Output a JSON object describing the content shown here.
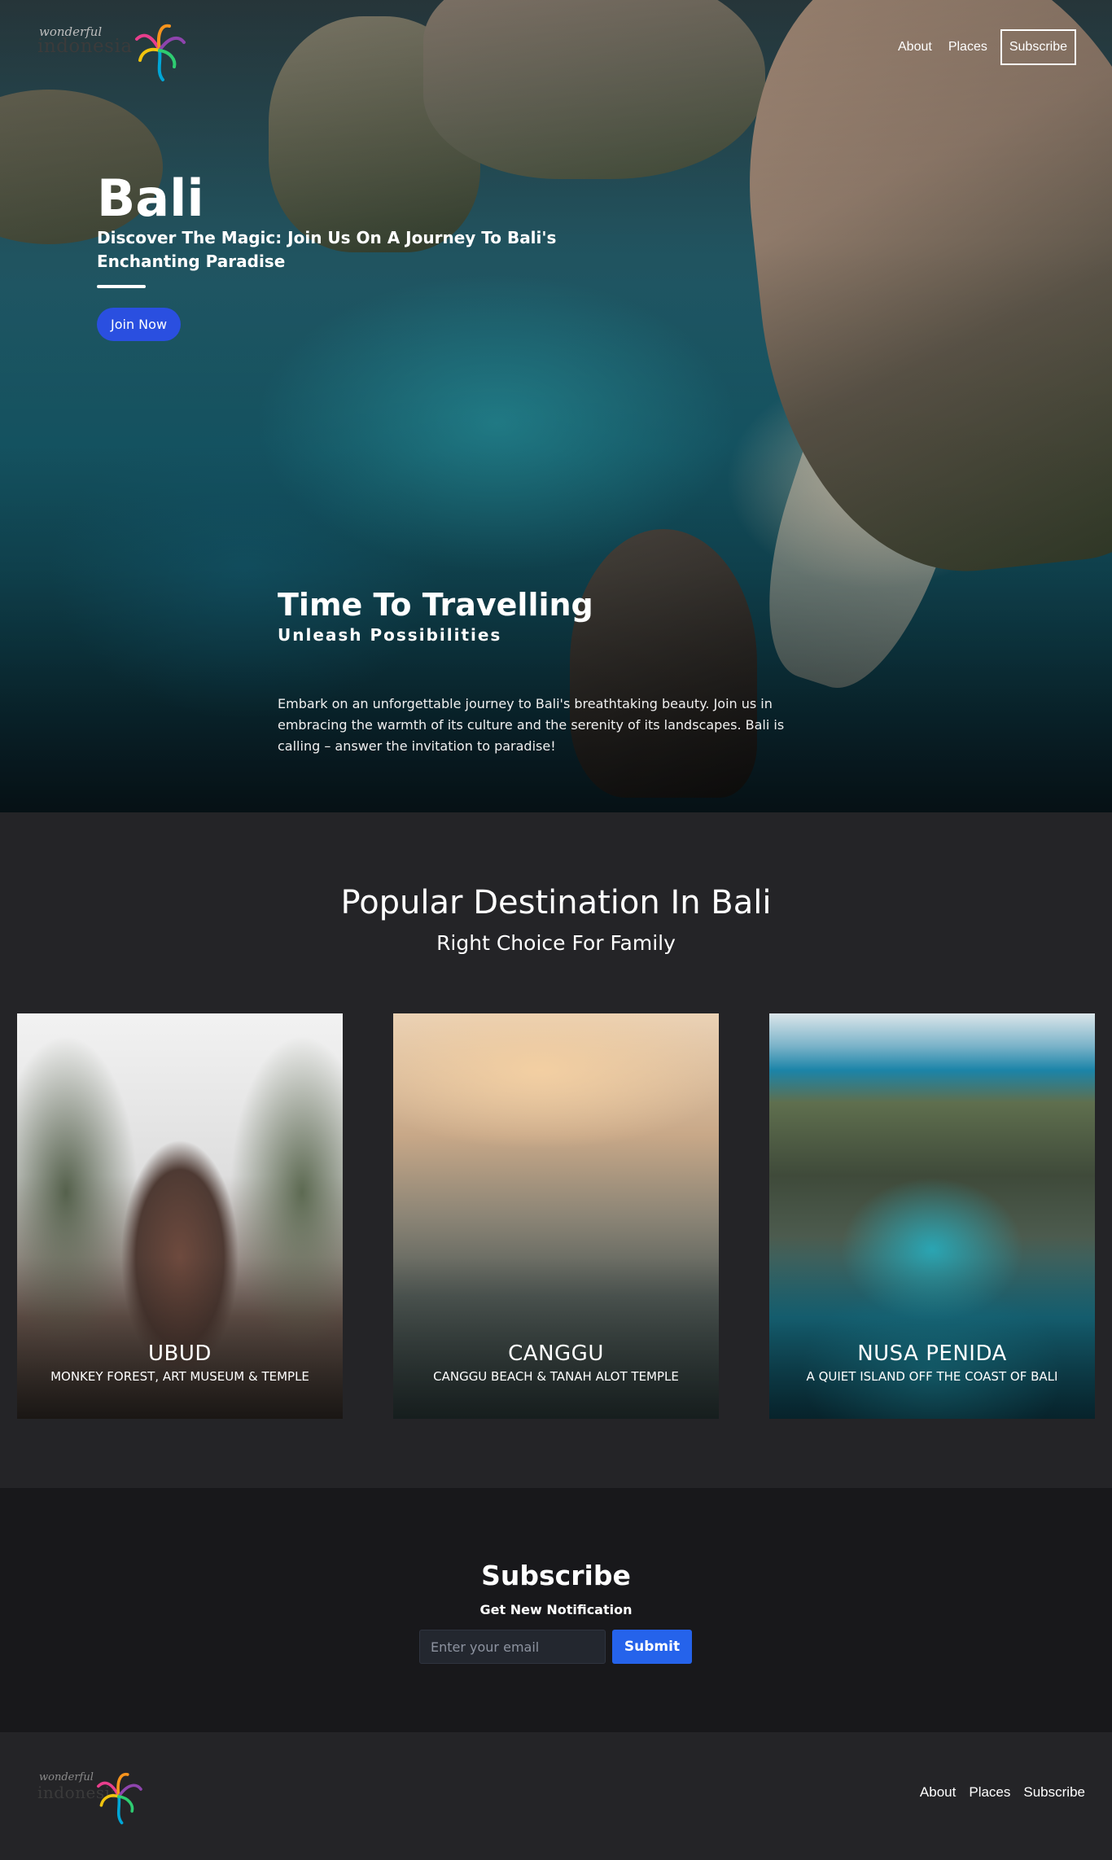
{
  "brand": {
    "logo_small": "wonderful",
    "logo_big": "indonesia"
  },
  "nav": {
    "about": "About",
    "places": "Places",
    "subscribe": "Subscribe"
  },
  "hero": {
    "title": "Bali",
    "subtitle": "Discover The Magic: Join Us On A Journey To Bali's Enchanting Paradise",
    "cta": "Join Now",
    "section_title": "Time To Travelling",
    "section_subtitle": "Unleash Possibilities",
    "body": "Embark on an unforgettable journey to Bali's breathtaking beauty. Join us in embracing the warmth of its culture and the serenity of its landscapes. Bali is calling – answer the invitation to paradise!"
  },
  "popular": {
    "title": "Popular Destination In Bali",
    "subtitle": "Right Choice For Family",
    "cards": [
      {
        "name": "UBUD",
        "desc": "MONKEY FOREST, ART MUSEUM & TEMPLE"
      },
      {
        "name": "CANGGU",
        "desc": "CANGGU BEACH & TANAH ALOT TEMPLE"
      },
      {
        "name": "NUSA PENIDA",
        "desc": "A QUIET ISLAND OFF THE COAST OF BALI"
      }
    ]
  },
  "subscribe": {
    "title": "Subscribe",
    "subtitle": "Get New Notification",
    "placeholder": "Enter your email",
    "submit": "Submit"
  },
  "footer": {
    "about": "About",
    "places": "Places",
    "subscribe": "Subscribe"
  },
  "colors": {
    "accent": "#2a4fe0",
    "submit": "#2563eb",
    "section_bg": "#242427",
    "subscribe_bg": "#18181b"
  }
}
